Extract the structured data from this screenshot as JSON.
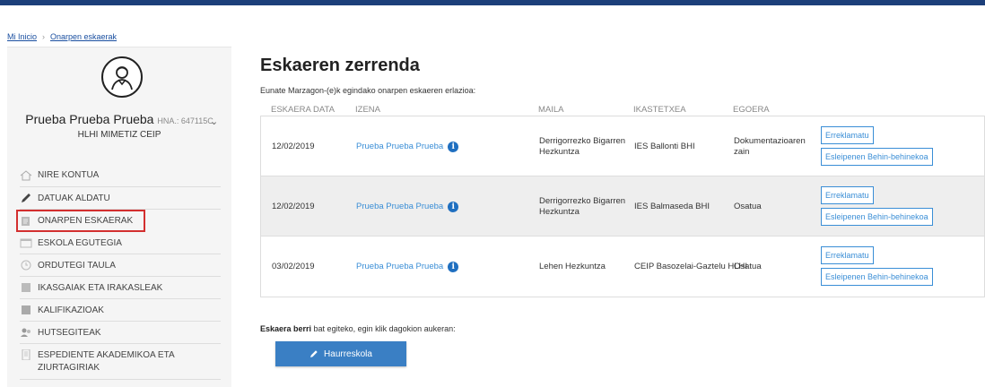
{
  "breadcrumb": {
    "home": "Mi Inicio",
    "current": "Onarpen eskaerak"
  },
  "user": {
    "name": "Prueba Prueba Prueba",
    "hna": "HNA.: 647115C",
    "school": "HLHI MIMETIZ CEIP"
  },
  "menu": [
    {
      "label": "NIRE KONTUA",
      "icon": "home-icon"
    },
    {
      "label": "DATUAK ALDATU",
      "icon": "pencil-icon"
    },
    {
      "label": "ONARPEN ESKAERAK",
      "icon": "document-icon"
    },
    {
      "label": "ESKOLA EGUTEGIA",
      "icon": "calendar-icon"
    },
    {
      "label": "ORDUTEGI TAULA",
      "icon": "clock-icon"
    },
    {
      "label": "IKASGAIAK ETA IRAKASLEAK",
      "icon": "book-icon"
    },
    {
      "label": "KALIFIKAZIOAK",
      "icon": "grades-icon"
    },
    {
      "label": "HUTSEGITEAK",
      "icon": "absence-icon"
    },
    {
      "label": "ESPEDIENTE AKADEMIKOA ETA",
      "label2": "ZIURTAGIRIAK",
      "icon": "file-icon"
    }
  ],
  "page": {
    "title": "Eskaeren zerrenda",
    "subtitle": "Eunate Marzagon-(e)k egindako onarpen eskaeren erlazioa:"
  },
  "table": {
    "headers": [
      "ESKAERA DATA",
      "IZENA",
      "MAILA",
      "IKASTETXEA",
      "EGOERA"
    ],
    "rows": [
      {
        "date": "12/02/2019",
        "name": "Prueba Prueba Prueba",
        "level1": "Derrigorrezko Bigarren",
        "level2": "Hezkuntza",
        "school": "IES Ballonti BHI",
        "status1": "Dokumentazioaren",
        "status2": "zain"
      },
      {
        "date": "12/02/2019",
        "name": "Prueba Prueba Prueba",
        "level1": "Derrigorrezko Bigarren",
        "level2": "Hezkuntza",
        "school": "IES Balmaseda BHI",
        "status1": "Osatua",
        "status2": ""
      },
      {
        "date": "03/02/2019",
        "name": "Prueba Prueba Prueba",
        "level1": "Lehen Hezkuntza",
        "level2": "",
        "school": "CEIP Basozelai-Gaztelu HLHI",
        "status1": "Osatua",
        "status2": ""
      }
    ],
    "btn_claim": "Erreklamatu",
    "btn_provisional": "Esleipenen Behin-behinekoa",
    "info_glyph": "i"
  },
  "footer": {
    "bold": "Eskaera berri",
    "rest": " bat egiteko, egin klik dagokion aukeran:",
    "button": "Haurreskola"
  },
  "colors": {
    "topbar": "#1c3f7a",
    "link": "#3a8ed6",
    "button_bg": "#3a7fc4",
    "highlight": "#d32f2f"
  }
}
